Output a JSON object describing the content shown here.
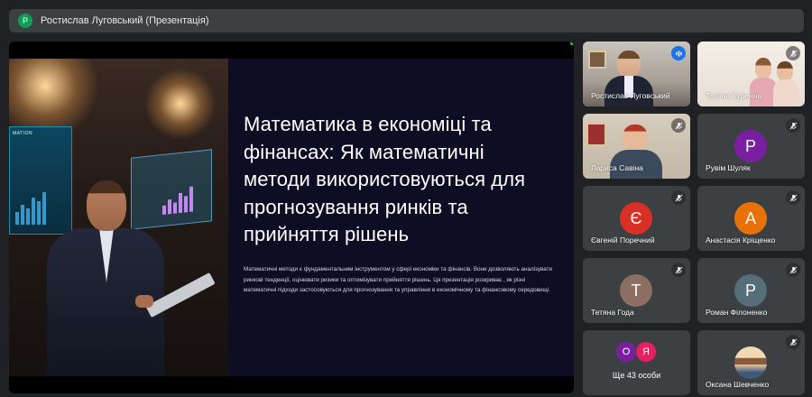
{
  "topbar": {
    "avatar_letter": "Р",
    "title": "Ростислав Луговський (Презентація)"
  },
  "slide": {
    "title": "Математика в економіці та фінансах: Як математичні методи використовуються для прогнозування ринків та прийняття рішень",
    "body": "Математичні методи є фундаментальним інструментом у сфері економіки та фінансів. Вони дозволяють аналізувати ринкові тенденції, оцінювати ризики та оптимізувати прийняття рішень. Ця презентація розкриває , як різні математичні підходи застосовуються для прогнозування та управління в економічному та фінансовому середовищі.",
    "photo_text": "MATION"
  },
  "participants": [
    {
      "name": "Ростислав Луговський",
      "type": "video",
      "mic": "speaking"
    },
    {
      "name": "Тетяна Куренна",
      "type": "video",
      "mic": "muted"
    },
    {
      "name": "Лариса Савіна",
      "type": "video",
      "mic": "muted"
    },
    {
      "name": "Рувім Шуляк",
      "letter": "Р",
      "color": "#7b1fa2",
      "mic": "muted"
    },
    {
      "name": "Євгеній Поречний",
      "letter": "Є",
      "color": "#d93025",
      "mic": "muted"
    },
    {
      "name": "Анастасія Кріщенко",
      "letter": "А",
      "color": "#e8710a",
      "mic": "muted"
    },
    {
      "name": "Тетяна Года",
      "letter": "Т",
      "color": "#8d6e63",
      "mic": "muted"
    },
    {
      "name": "Роман Філоненко",
      "letter": "Р",
      "color": "#546e7a",
      "mic": "muted"
    },
    {
      "name": "Ще 43 особи",
      "type": "more",
      "letters": [
        "О",
        "Я"
      ],
      "colors": [
        "#7b1fa2",
        "#e91e63"
      ]
    },
    {
      "name": "Оксана Шевченко",
      "type": "photo",
      "mic": "muted"
    }
  ]
}
